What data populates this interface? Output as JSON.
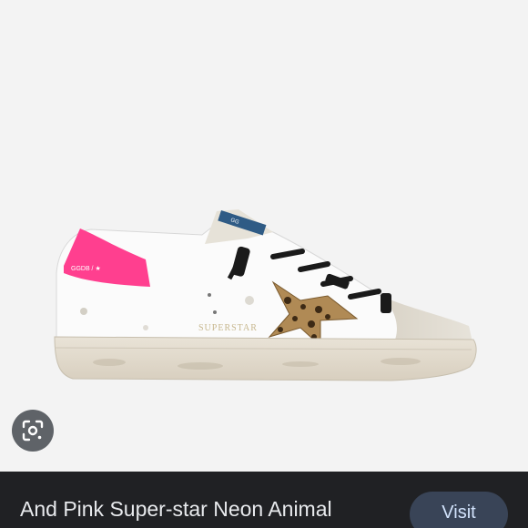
{
  "image": {
    "alt": "And Pink Super-star Neon Animal"
  },
  "lens": {
    "icon": "lens-icon"
  },
  "footer": {
    "title": "And Pink Super-star Neon Animal",
    "visit_label": "Visit"
  },
  "colors": {
    "background": "#f3f3f3",
    "footer": "#202124",
    "visit_button": "#394457",
    "accent_pink": "#ff3f8f"
  }
}
